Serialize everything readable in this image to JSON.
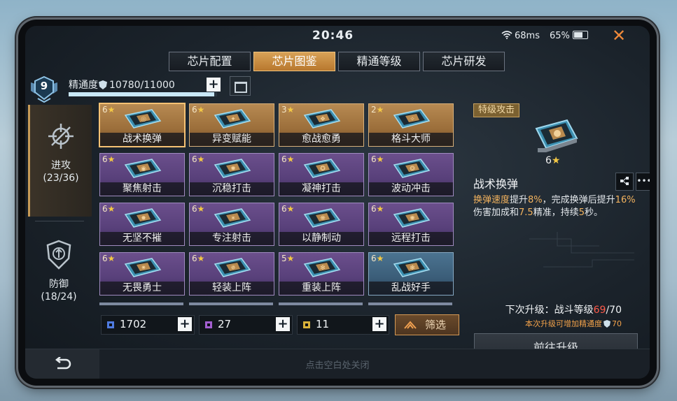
{
  "status": {
    "time": "20:46",
    "ping": "68ms",
    "battery": "65%"
  },
  "colors": {
    "accent": "#d8a257",
    "highlight": "#f3b35e",
    "warn": "#ff5a4a",
    "gold_star": "#f3c845"
  },
  "tabs": [
    {
      "label": "芯片配置",
      "active": false
    },
    {
      "label": "芯片图鉴",
      "active": true
    },
    {
      "label": "精通等级",
      "active": false
    },
    {
      "label": "芯片研发",
      "active": false
    }
  ],
  "player": {
    "level": "9",
    "mastery_label": "精通度",
    "mastery_value": "10780/11000",
    "mastery_fraction": 0.98
  },
  "sidebar": [
    {
      "label": "进攻",
      "count": "(23/36)",
      "icon": "crosshair-icon",
      "active": true
    },
    {
      "label": "防御",
      "count": "(18/24)",
      "icon": "shield-icon",
      "active": false
    }
  ],
  "chips": [
    {
      "stars": "6",
      "name": "战术换弹",
      "rarity": "gold",
      "selected": true
    },
    {
      "stars": "6",
      "name": "异变赋能",
      "rarity": "gold"
    },
    {
      "stars": "3",
      "name": "愈战愈勇",
      "rarity": "gold"
    },
    {
      "stars": "2",
      "name": "格斗大师",
      "rarity": "gold"
    },
    {
      "stars": "6",
      "name": "聚焦射击",
      "rarity": "purple"
    },
    {
      "stars": "6",
      "name": "沉稳打击",
      "rarity": "purple"
    },
    {
      "stars": "6",
      "name": "凝神打击",
      "rarity": "purple"
    },
    {
      "stars": "6",
      "name": "波动冲击",
      "rarity": "purple"
    },
    {
      "stars": "6",
      "name": "无坚不摧",
      "rarity": "purple"
    },
    {
      "stars": "6",
      "name": "专注射击",
      "rarity": "purple"
    },
    {
      "stars": "6",
      "name": "以静制动",
      "rarity": "purple"
    },
    {
      "stars": "6",
      "name": "远程打击",
      "rarity": "purple"
    },
    {
      "stars": "6",
      "name": "无畏勇士",
      "rarity": "purple"
    },
    {
      "stars": "6",
      "name": "轻装上阵",
      "rarity": "purple"
    },
    {
      "stars": "5",
      "name": "重装上阵",
      "rarity": "purple"
    },
    {
      "stars": "6",
      "name": "乱战好手",
      "rarity": "blue"
    }
  ],
  "resources": [
    {
      "value": "1702",
      "color": "#4f7be0"
    },
    {
      "value": "27",
      "color": "#a35fd0"
    },
    {
      "value": "11",
      "color": "#d8b13a"
    }
  ],
  "filter_label": "筛选",
  "detail": {
    "tag": "特级攻击",
    "stars": "6",
    "name": "战术换弹",
    "desc_hl": "换弹速度",
    "desc_a": "提升",
    "desc_v1": "8%",
    "desc_b": "，完成换弹后提升",
    "desc_v2": "16%",
    "desc_c": "伤害加成和",
    "desc_v3": "7.5",
    "desc_d": "精准，持续",
    "desc_v4": "5",
    "desc_e": "秒。",
    "next_label": "下次升级：战斗等级",
    "next_current": "69",
    "next_max": "/70",
    "hint": "本次升级可增加精通度",
    "hint_value": "70",
    "upgrade_label": "前往升级"
  },
  "bottom": {
    "close_hint": "点击空白处关闭"
  }
}
